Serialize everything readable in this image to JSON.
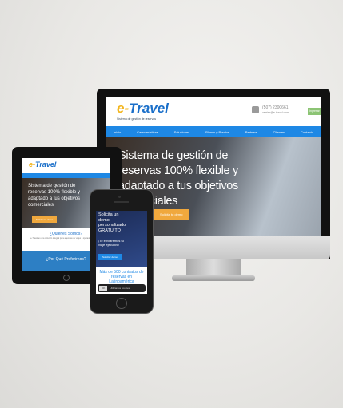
{
  "site": {
    "logo_prefix": "e-",
    "logo_main": "Travel",
    "tagline": "Sistema de gestión de reservas",
    "phone": "(507) 2300661",
    "email": "ventas@e-travel.com",
    "register_label": "Ingresar",
    "nav": [
      "Inicio",
      "Características",
      "Soluciones",
      "Planes y Precios",
      "Partners",
      "Clientes",
      "Contacto"
    ],
    "hero_title": "Sistema de gestión de reservas 100% flexible y adaptado a tus objetivos comerciales",
    "cta_label": "Solicita tu demo"
  },
  "tablet": {
    "hero_title": "Sistema de gestión de reservas 100% flexible y adaptado a tus objetivos comerciales",
    "section_title": "¿Quiénes Somos?",
    "section_text": "e-Travel es una solución integral para agencias de viajes y operadores turísticos.",
    "blue_title": "¿Por Qué Preferirnos?"
  },
  "phone": {
    "hero_title": "Solicita un demo personalizado GRATUITO",
    "hero_sub": "¡Te enviaremos tu viaje ejecutivo!",
    "cta_label": "Solicitar demo",
    "stat_title": "Más de 500 contratos de reservas en Latinoamérica",
    "toast_button": "OK",
    "toast_text": "Utilizamos cookies"
  },
  "colors": {
    "brand_blue": "#1e88e5",
    "accent_orange": "#f0a83d"
  }
}
